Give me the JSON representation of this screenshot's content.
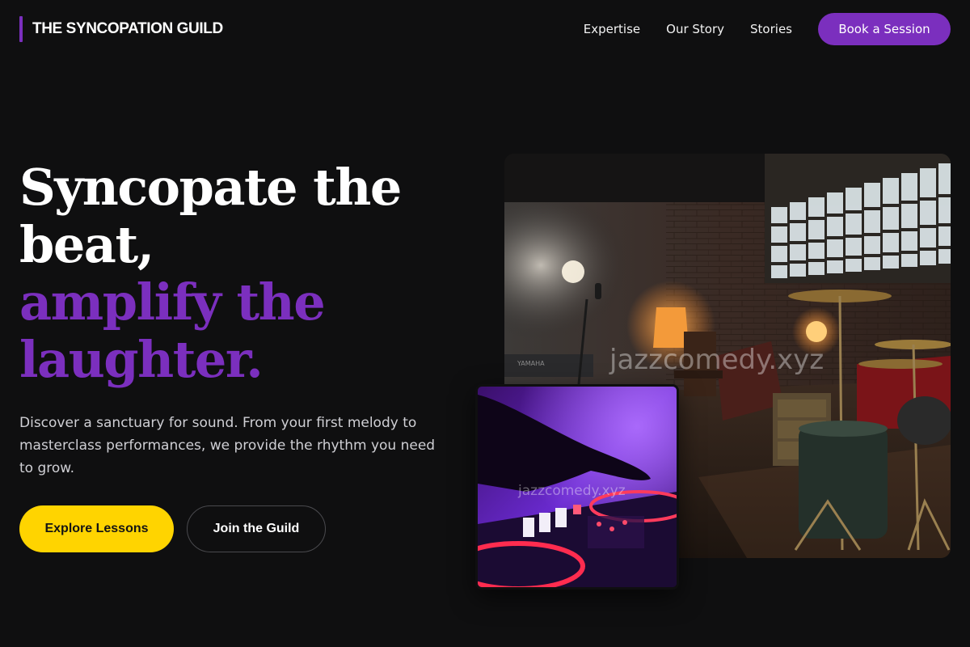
{
  "header": {
    "brand": "THE SYNCOPATION GUILD",
    "nav": [
      "Expertise",
      "Our Story",
      "Stories"
    ],
    "cta": "Book a Session"
  },
  "hero": {
    "title_lines": [
      "Syncopate the",
      "beat,"
    ],
    "accent_lines": [
      "amplify the",
      "laughter."
    ],
    "subtitle": "Discover a sanctuary for sound. From your first melody to masterclass performances, we provide the rhythm you need to grow.",
    "primary_button": "Explore Lessons",
    "secondary_button": "Join the Guild"
  },
  "images": {
    "main_watermark": "jazzcomedy.xyz",
    "secondary_watermark": "jazzcomedy.xyz",
    "piano_brand": "YAMAHA"
  },
  "colors": {
    "background": "#0f0f10",
    "accent": "#7b2fbe",
    "primary_button": "#ffd400"
  }
}
